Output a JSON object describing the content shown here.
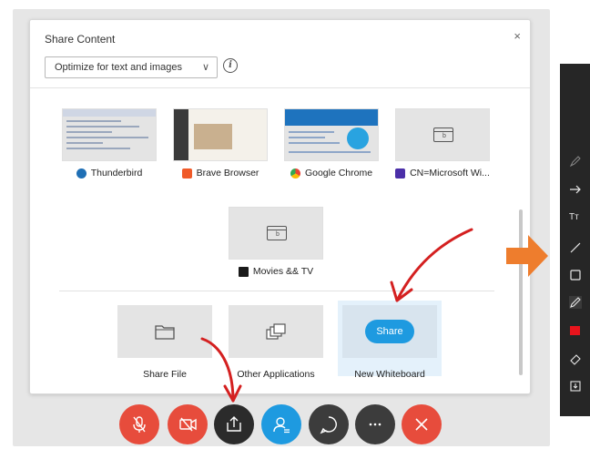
{
  "dialog": {
    "title": "Share Content",
    "close_glyph": "×",
    "optimize_select": {
      "value": "Optimize for text and images",
      "chevron": "∨"
    },
    "info_glyph": "i"
  },
  "apps": [
    {
      "label": "Thunderbird",
      "icon": "thunderbird-icon",
      "icon_color": "#1f6fb5"
    },
    {
      "label": "Brave Browser",
      "icon": "brave-icon",
      "icon_color": "#f05a28"
    },
    {
      "label": "Google Chrome",
      "icon": "chrome-icon",
      "icon_color": "#4285f4"
    },
    {
      "label": "CN=Microsoft Wi...",
      "icon": "window-icon",
      "icon_color": "#4b2fa8"
    },
    {
      "label": "Movies && TV",
      "icon": "movies-tv-icon",
      "icon_color": "#1a1a1a"
    }
  ],
  "window_glyph": "b",
  "options": [
    {
      "label": "Share File",
      "icon": "folder-icon"
    },
    {
      "label": "Other Applications",
      "icon": "stacked-windows-icon"
    },
    {
      "label": "New Whiteboard",
      "button": "Share"
    }
  ],
  "controls": [
    {
      "name": "mute-mic-button",
      "color": "#e74c3c"
    },
    {
      "name": "stop-video-button",
      "color": "#e74c3c"
    },
    {
      "name": "share-button",
      "color": "#2b2b2b"
    },
    {
      "name": "participants-button",
      "color": "#1e9ae0"
    },
    {
      "name": "chat-button",
      "color": "#3c3c3c"
    },
    {
      "name": "more-button",
      "color": "#3c3c3c"
    },
    {
      "name": "leave-button",
      "color": "#e74c3c"
    }
  ],
  "toolbar": {
    "text_tool": "Tт",
    "color_swatch": "#e8141c"
  },
  "colors": {
    "accent": "#1e9ae0",
    "annotation": "#d42020",
    "orange_arrow": "#ee7d2d"
  }
}
